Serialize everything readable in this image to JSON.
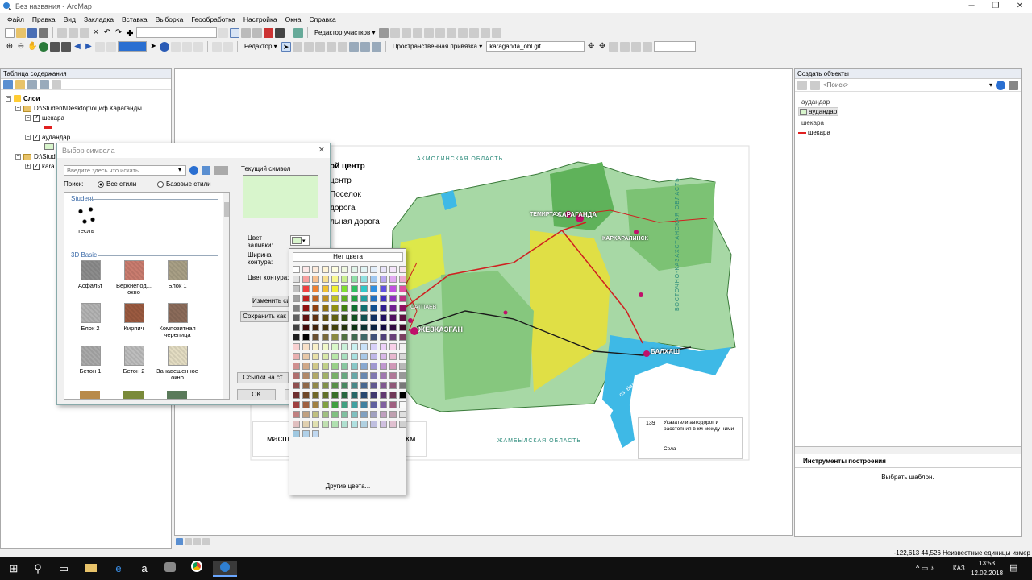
{
  "window": {
    "title": "Без названия - ArcMap"
  },
  "menu": [
    "Файл",
    "Правка",
    "Вид",
    "Закладка",
    "Вставка",
    "Выборка",
    "Геообработка",
    "Настройка",
    "Окна",
    "Справка"
  ],
  "toolbar": {
    "parcel_editor": "Редактор участков ▾",
    "editor": "Редактор ▾",
    "georef": "Пространственная привязка ▾",
    "georef_layer": "karaganda_obl.gif"
  },
  "toc": {
    "title": "Таблица содержания",
    "layers_label": "Слои",
    "folder1": "D:\\Student\\Desktop\\оциф Караганды",
    "layer1": "шекара",
    "layer2": "аудандар",
    "folder2": "D:\\Stud",
    "layer3": "karа"
  },
  "dialog": {
    "title": "Выбор символа",
    "search_placeholder": "Введите здесь что искать",
    "search_label": "Поиск:",
    "radio_all": "Все стили",
    "radio_base": "Базовые стили",
    "group_student": "Student",
    "sym_geslp": "геслъ",
    "group_3d": "3D Basic",
    "symbols": [
      {
        "name": "Асфальт",
        "color": "#8c8c8c"
      },
      {
        "name": "Верхнепод... окно",
        "color": "#c97c6f"
      },
      {
        "name": "Блок 1",
        "color": "#a89f85"
      },
      {
        "name": "Блок 2",
        "color": "#b3b3b3"
      },
      {
        "name": "Кирпич",
        "color": "#9b5a40"
      },
      {
        "name": "Композитная черепица",
        "color": "#8b6b5a"
      },
      {
        "name": "Бетон 1",
        "color": "#a9a9a9"
      },
      {
        "name": "Бетон 2",
        "color": "#bdbdbd"
      },
      {
        "name": "Занавешенное окно",
        "color": "#e3dcc2"
      }
    ],
    "current_symbol_label": "Текущий символ",
    "fill_color_label": "Цвет заливки:",
    "outline_width_label": "Ширина контура:",
    "outline_color_label": "Цвет контура:",
    "edit_symbol": "Изменить симв",
    "save_as": "Сохранить как",
    "style_refs": "Ссылки на ст",
    "ok": "OK",
    "fill_color": "#d8f5cc"
  },
  "palette": {
    "no_color": "Нет цвета",
    "more_colors": "Другие цвета..."
  },
  "map": {
    "akmola": "АКМОЛИНСКАЯ ОБЛАСТЬ",
    "east_kaz": "ВОСТОЧНО-КАЗАХСТАНСКАЯ ОБЛАСТЬ",
    "zhambyl": "ЖАМБЫЛСКАЯ ОБЛАСТЬ",
    "balkhash_lake": "оз. Балхаш",
    "legend1": "ой центр",
    "legend2": "центр",
    "legend3": "Поселок",
    "legend4": "дорога",
    "legend5": "льная дорога",
    "masht": "масш",
    "km": "км",
    "dist_legend": "Указатели автодорог и расстояния в км между ними",
    "dist_num": "139",
    "selo": "Села",
    "cities": [
      {
        "n": "КАРАГАНДА",
        "c": "#fff"
      },
      {
        "n": "ТЕМИРТАУ",
        "c": "#fff"
      },
      {
        "n": "ЖЕЗКАЗГАН",
        "c": "#fff"
      },
      {
        "n": "БАЛХАШ",
        "c": "#fff"
      },
      {
        "n": "САТПАЕВ",
        "c": "#fff"
      },
      {
        "n": "КАРКАРАЛИНСК",
        "c": "#fff"
      }
    ]
  },
  "right": {
    "title": "Создать объекты",
    "search": "<Поиск>",
    "group1": "аудандар",
    "item1": "аудандар",
    "group2": "шекара",
    "item2": "шекара",
    "tools_title": "Инструменты построения",
    "choose_template": "Выбрать шаблон."
  },
  "status": {
    "coords": "-122,613  44,526 Неизвестные единицы измер"
  },
  "clock": {
    "time": "13:53",
    "date": "12.02.2018",
    "lang": "КАЗ"
  }
}
